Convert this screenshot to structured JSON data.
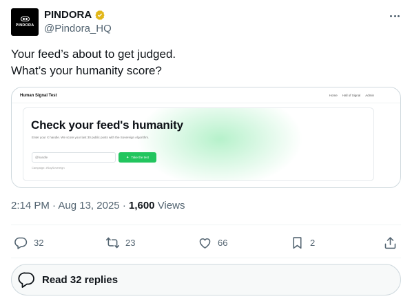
{
  "author": {
    "avatar_text": "PINDORA",
    "display_name": "PINDORA",
    "handle": "@Pindora_HQ",
    "verified_color": "#e2b719"
  },
  "tweet": {
    "line1": "Your feed’s about to get judged.",
    "line2": "What’s your humanity score?"
  },
  "card": {
    "nav_title": "Human Signal Test",
    "nav_links": [
      "Home",
      "Hall of Signal",
      "Admin"
    ],
    "headline": "Check your feed's humanity",
    "description": "Enter your X handle. We score your last 30 public posts with the Sovereign Algorithm.",
    "input_placeholder": "@handle",
    "button_label": "Take the test",
    "campaign": "Campaign: #SaySovereign",
    "accent_color": "#22c55e"
  },
  "meta": {
    "time": "2:14 PM",
    "date": "Aug 13, 2025",
    "views_count": "1,600",
    "views_label": "Views",
    "sep": "·"
  },
  "actions": {
    "replies": "32",
    "reposts": "23",
    "likes": "66",
    "bookmarks": "2"
  },
  "read_replies": "Read 32 replies"
}
